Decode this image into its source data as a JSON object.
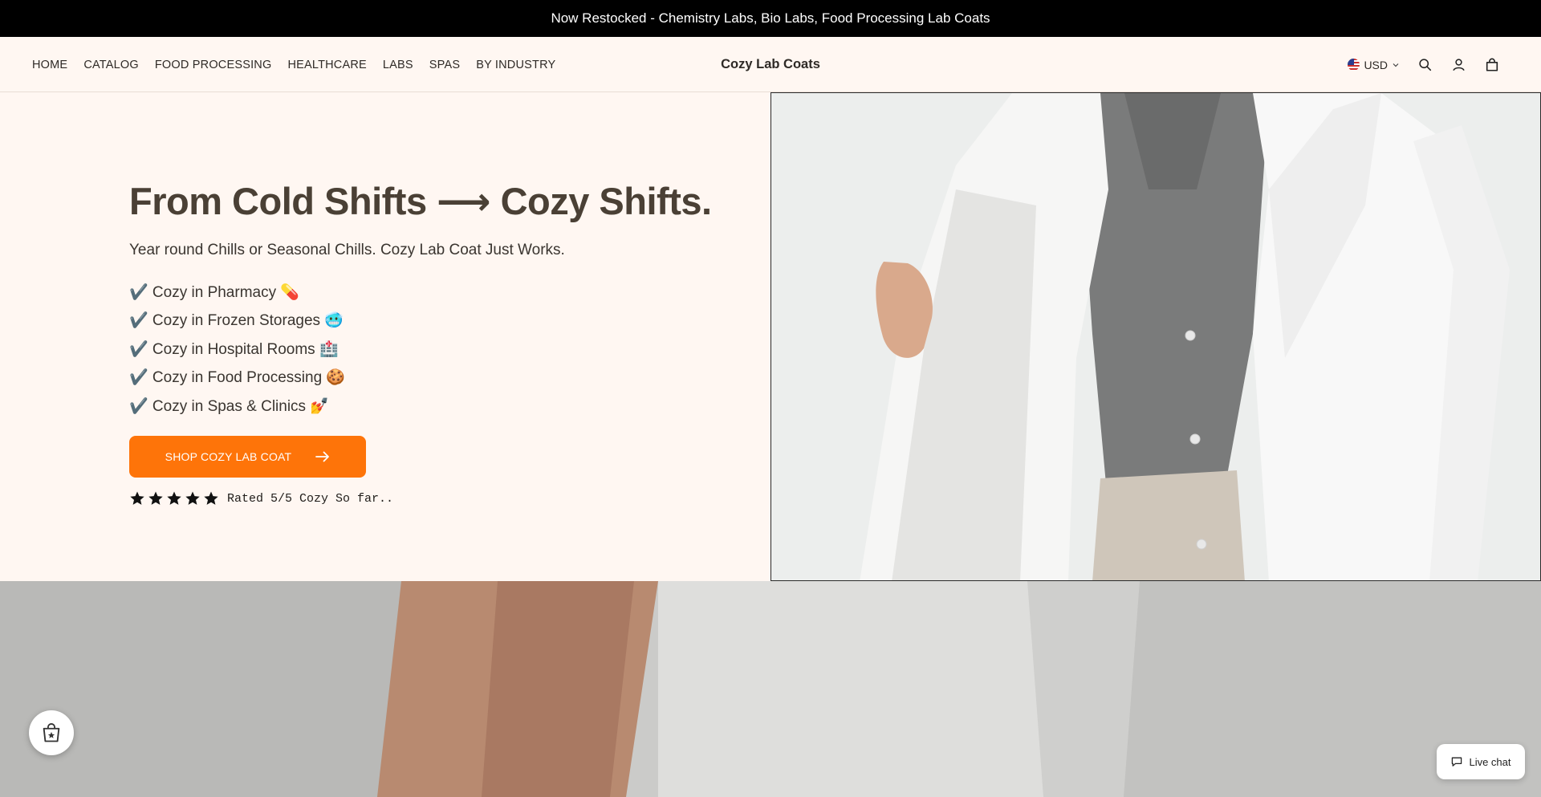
{
  "announcement": "Now Restocked - Chemistry Labs, Bio Labs, Food Processing Lab Coats",
  "nav": {
    "items": [
      {
        "label": "HOME"
      },
      {
        "label": "CATALOG"
      },
      {
        "label": "FOOD PROCESSING"
      },
      {
        "label": "HEALTHCARE"
      },
      {
        "label": "LABS"
      },
      {
        "label": "SPAS"
      },
      {
        "label": "BY INDUSTRY"
      }
    ]
  },
  "brand": "Cozy Lab Coats",
  "tools": {
    "currency": "USD",
    "icons": [
      "flag-us-icon",
      "chevron-down-icon",
      "search-icon",
      "account-icon",
      "cart-icon"
    ]
  },
  "hero": {
    "title": "From Cold Shifts ⟶ Cozy Shifts.",
    "subtitle": "Year round Chills or Seasonal Chills. Cozy Lab Coat Just Works.",
    "bullets": [
      "✔️ Cozy in Pharmacy 💊",
      "✔️ Cozy in Frozen Storages 🥶",
      "✔️ Cozy in Hospital Rooms 🏥",
      "✔️ Cozy in Food Processing 🍪",
      "✔️ Cozy in Spas & Clinics 💅"
    ],
    "cta_label": "SHOP COZY LAB COAT",
    "rating": {
      "stars": 5,
      "max": 5,
      "text": "Rated 5/5 Cozy So far.."
    }
  },
  "widgets": {
    "live_chat": "Live chat"
  },
  "colors": {
    "accent": "#fe7409",
    "background": "#fff7f2",
    "announcement_bg": "#000000",
    "title": "#4a4035"
  }
}
